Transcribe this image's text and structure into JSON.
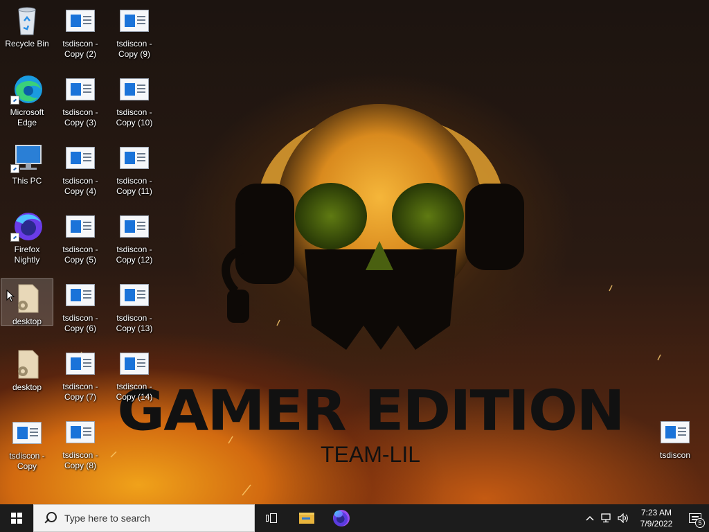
{
  "wallpaper": {
    "title": "GAMER EDITION",
    "subtitle": "TEAM-LIL"
  },
  "desktop": {
    "icons": [
      {
        "id": "recycle-bin",
        "label": "Recycle Bin",
        "icon": "recycle-bin-icon"
      },
      {
        "id": "edge",
        "label": "Microsoft Edge",
        "icon": "edge-icon",
        "shortcut": true
      },
      {
        "id": "this-pc",
        "label": "This PC",
        "icon": "monitor-icon",
        "shortcut": true
      },
      {
        "id": "firefox",
        "label": "Firefox Nightly",
        "icon": "firefox-icon",
        "shortcut": true
      },
      {
        "id": "desktop-1",
        "label": "desktop",
        "icon": "settings-file-icon",
        "selected": true
      },
      {
        "id": "desktop-2",
        "label": "desktop",
        "icon": "settings-file-icon"
      },
      {
        "id": "tsdiscon-copy",
        "label": "tsdiscon - Copy",
        "icon": "rdp-file-icon"
      },
      {
        "id": "tsdiscon-2",
        "label": "tsdiscon - Copy (2)",
        "icon": "rdp-file-icon"
      },
      {
        "id": "tsdiscon-3",
        "label": "tsdiscon - Copy (3)",
        "icon": "rdp-file-icon"
      },
      {
        "id": "tsdiscon-4",
        "label": "tsdiscon - Copy (4)",
        "icon": "rdp-file-icon"
      },
      {
        "id": "tsdiscon-5",
        "label": "tsdiscon - Copy (5)",
        "icon": "rdp-file-icon"
      },
      {
        "id": "tsdiscon-6",
        "label": "tsdiscon - Copy (6)",
        "icon": "rdp-file-icon"
      },
      {
        "id": "tsdiscon-7",
        "label": "tsdiscon - Copy (7)",
        "icon": "rdp-file-icon"
      },
      {
        "id": "tsdiscon-8",
        "label": "tsdiscon - Copy (8)",
        "icon": "rdp-file-icon"
      },
      {
        "id": "tsdiscon-9",
        "label": "tsdiscon - Copy (9)",
        "icon": "rdp-file-icon"
      },
      {
        "id": "tsdiscon-10",
        "label": "tsdiscon - Copy (10)",
        "icon": "rdp-file-icon"
      },
      {
        "id": "tsdiscon-11",
        "label": "tsdiscon - Copy (11)",
        "icon": "rdp-file-icon"
      },
      {
        "id": "tsdiscon-12",
        "label": "tsdiscon - Copy (12)",
        "icon": "rdp-file-icon"
      },
      {
        "id": "tsdiscon-13",
        "label": "tsdiscon - Copy (13)",
        "icon": "rdp-file-icon"
      },
      {
        "id": "tsdiscon-14",
        "label": "tsdiscon - Copy (14)",
        "icon": "rdp-file-icon"
      },
      {
        "id": "tsdiscon",
        "label": "tsdiscon",
        "icon": "rdp-file-icon"
      }
    ]
  },
  "taskbar": {
    "search_placeholder": "Type here to search",
    "clock_time": "7:23 AM",
    "clock_date": "7/9/2022",
    "notification_count": "5"
  }
}
